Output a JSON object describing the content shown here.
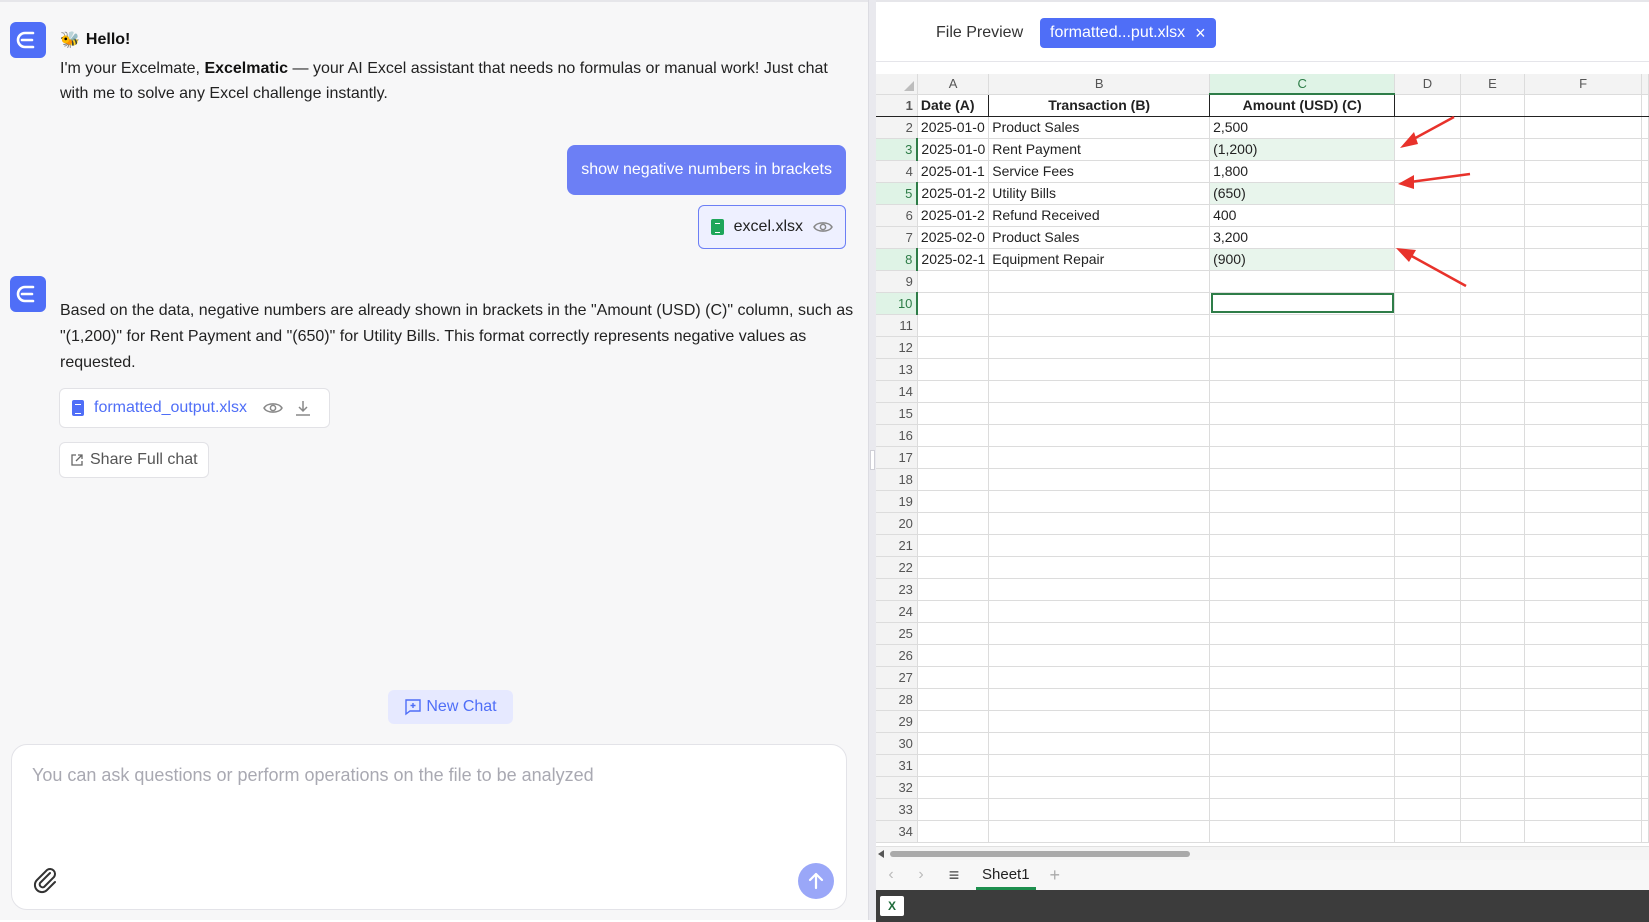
{
  "chat": {
    "greeting": "Hello!",
    "intro_prefix": "I'm your Excelmate, ",
    "intro_brand": "Excelmatic",
    "intro_suffix": " — your AI Excel assistant that needs no formulas or manual work! Just chat with me to solve any Excel challenge instantly.",
    "user_message": "show negative numbers in brackets",
    "user_file": "excel.xlsx",
    "answer": "Based on the data, negative numbers are already shown in brackets in the \"Amount (USD) (C)\" column, such as \"(1,200)\" for Rent Payment and \"(650)\" for Utility Bills. This format correctly represents negative values as requested.",
    "output_file": "formatted_output.xlsx",
    "share_label": "Share Full chat",
    "new_chat_label": "New Chat",
    "input_placeholder": "You can ask questions or perform operations on the file to be analyzed",
    "accent_color": "#4f6ef7"
  },
  "preview": {
    "title": "File Preview",
    "tab_label": "formatted...put.xlsx",
    "columns": [
      "A",
      "B",
      "C",
      "D",
      "E",
      "F"
    ],
    "header_row": [
      "Date (A)",
      "Transaction (B)",
      "Amount (USD) (C)"
    ],
    "rows": [
      [
        "2025-01-0",
        "Product Sales",
        "2,500"
      ],
      [
        "2025-01-0",
        "Rent Payment",
        "(1,200)"
      ],
      [
        "2025-01-1",
        "Service Fees",
        "1,800"
      ],
      [
        "2025-01-2",
        "Utility Bills",
        "(650)"
      ],
      [
        "2025-01-2",
        "Refund Received",
        "400"
      ],
      [
        "2025-02-0",
        "Product Sales",
        "3,200"
      ],
      [
        "2025-02-1",
        "Equipment Repair",
        "(900)"
      ]
    ],
    "negative_rows": [
      3,
      5,
      8
    ],
    "selected_column": "C",
    "selected_row": 10,
    "total_rows": 34,
    "sheet_name": "Sheet1",
    "highlight_color": "#e8f5ec",
    "arrow_color": "#e8322b"
  }
}
